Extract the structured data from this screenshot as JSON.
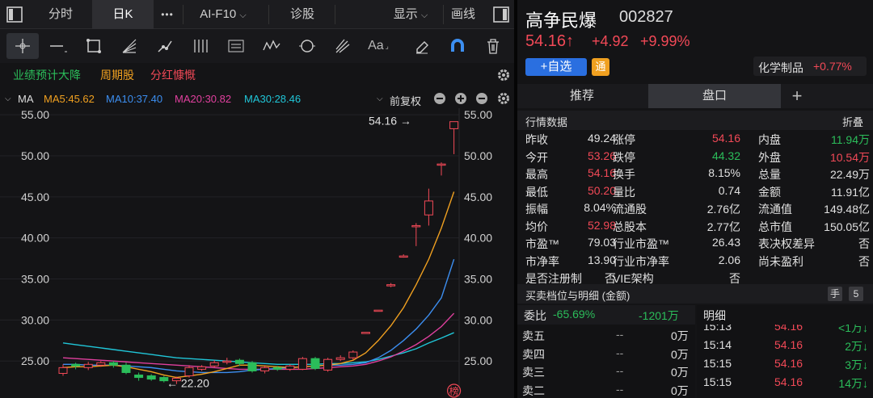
{
  "topbar": {
    "tab_intraday": "分时",
    "tab_daily": "日K",
    "more": "•••",
    "tab_f10": "AI-F10",
    "tab_diagnose": "诊股",
    "display": "显示",
    "draw": "画线"
  },
  "tags": [
    "业绩预计大降",
    "周期股",
    "分红慷慨"
  ],
  "tag_colors": [
    "#2bbd5a",
    "#f0a020",
    "#f24957"
  ],
  "ma": {
    "label": "MA",
    "ma5": "MA5:45.62",
    "ma10": "MA10:37.40",
    "ma20": "MA20:30.82",
    "ma30": "MA30:28.46",
    "adjust": "前复权",
    "colors": {
      "ma5": "#f0a020",
      "ma10": "#3c8ef0",
      "ma20": "#e0409e",
      "ma30": "#20c6d8"
    }
  },
  "stock": {
    "name": "高争民爆",
    "code": "002827",
    "price": "54.16↑",
    "change": "+4.92",
    "pct": "+9.99%",
    "add_watch": "+自选",
    "tong": "通",
    "industry": "化学制品",
    "industry_pct": "+0.77%"
  },
  "right_tabs": {
    "tab1": "推荐",
    "tab2": "盘口",
    "add": "+"
  },
  "quote": {
    "title": "行情数据",
    "collapse": "折叠",
    "rows": [
      [
        [
          "昨收",
          "49.24",
          "white"
        ],
        [
          "涨停",
          "54.16",
          "red"
        ],
        [
          "内盘",
          "11.94万",
          "green"
        ]
      ],
      [
        [
          "今开",
          "53.26",
          "red"
        ],
        [
          "跌停",
          "44.32",
          "green"
        ],
        [
          "外盘",
          "10.54万",
          "red"
        ]
      ],
      [
        [
          "最高",
          "54.16",
          "red"
        ],
        [
          "换手",
          "8.15%",
          "white"
        ],
        [
          "总量",
          "22.49万",
          "white"
        ]
      ],
      [
        [
          "最低",
          "50.20",
          "red"
        ],
        [
          "量比",
          "0.74",
          "white"
        ],
        [
          "金额",
          "11.91亿",
          "white"
        ]
      ],
      [
        [
          "振幅",
          "8.04%",
          "white"
        ],
        [
          "流通股",
          "2.76亿",
          "white"
        ],
        [
          "流通值",
          "149.48亿",
          "white"
        ]
      ],
      [
        [
          "均价",
          "52.98",
          "red"
        ],
        [
          "总股本",
          "2.77亿",
          "white"
        ],
        [
          "总市值",
          "150.05亿",
          "white"
        ]
      ],
      [
        [
          "市盈™",
          "79.03",
          "white"
        ],
        [
          "行业市盈™",
          "26.43",
          "white"
        ],
        [
          "表决权差异",
          "否",
          "white"
        ]
      ],
      [
        [
          "市净率",
          "13.90",
          "white"
        ],
        [
          "行业市净率",
          "2.06",
          "white"
        ],
        [
          "尚未盈利",
          "否",
          "white"
        ]
      ],
      [
        [
          "是否注册制",
          "否",
          "white"
        ],
        [
          "VIE架构",
          "否",
          "white"
        ],
        [
          "",
          "",
          ""
        ]
      ]
    ]
  },
  "orderbook": {
    "title": "买卖档位与明细 (金额)",
    "hand": "手",
    "num": "5",
    "ratio_label": "委比",
    "ratio": "-65.69%",
    "diff": "-1201万",
    "detail_title": "明细",
    "sells": [
      [
        "卖五",
        "--",
        "0万"
      ],
      [
        "卖四",
        "--",
        "0万"
      ],
      [
        "卖三",
        "--",
        "0万"
      ],
      [
        "卖二",
        "--",
        "0万"
      ]
    ],
    "ticks": [
      [
        "15:13",
        "54.16",
        "<1万↓"
      ],
      [
        "15:14",
        "54.16",
        "2万↓"
      ],
      [
        "15:15",
        "54.16",
        "3万↓"
      ],
      [
        "15:15",
        "54.16",
        "14万↓"
      ]
    ]
  },
  "chart_data": {
    "type": "candlestick",
    "y_ticks": [
      "55.00",
      "50.00",
      "45.00",
      "40.00",
      "35.00",
      "30.00",
      "25.00"
    ],
    "ylim": [
      20.5,
      55.8
    ],
    "high_label": "54.16",
    "low_label": "22.20",
    "badge": "榜",
    "candles": [
      {
        "o": 23.5,
        "c": 24.2,
        "h": 24.6,
        "l": 23.2
      },
      {
        "o": 24.6,
        "c": 24.4,
        "h": 24.8,
        "l": 24.0
      },
      {
        "o": 24.2,
        "c": 24.6,
        "h": 24.9,
        "l": 23.9
      },
      {
        "o": 24.5,
        "c": 24.8,
        "h": 25.0,
        "l": 24.3
      },
      {
        "o": 24.8,
        "c": 24.5,
        "h": 25.0,
        "l": 24.2
      },
      {
        "o": 24.5,
        "c": 23.6,
        "h": 24.8,
        "l": 23.4
      },
      {
        "o": 23.3,
        "c": 23.0,
        "h": 23.6,
        "l": 22.6
      },
      {
        "o": 23.2,
        "c": 22.8,
        "h": 23.4,
        "l": 22.6
      },
      {
        "o": 23.0,
        "c": 22.6,
        "h": 23.2,
        "l": 22.4
      },
      {
        "o": 22.6,
        "c": 22.9,
        "h": 23.1,
        "l": 22.2
      },
      {
        "o": 23.2,
        "c": 24.2,
        "h": 24.5,
        "l": 23.0
      },
      {
        "o": 24.0,
        "c": 24.3,
        "h": 24.5,
        "l": 23.8
      },
      {
        "o": 24.4,
        "c": 24.8,
        "h": 25.1,
        "l": 24.2
      },
      {
        "o": 24.9,
        "c": 25.0,
        "h": 25.4,
        "l": 24.6
      },
      {
        "o": 25.1,
        "c": 24.7,
        "h": 25.3,
        "l": 24.4
      },
      {
        "o": 24.8,
        "c": 23.8,
        "h": 25.0,
        "l": 23.6
      },
      {
        "o": 23.8,
        "c": 24.2,
        "h": 24.5,
        "l": 23.5
      },
      {
        "o": 24.2,
        "c": 24.0,
        "h": 24.4,
        "l": 23.8
      },
      {
        "o": 24.0,
        "c": 24.4,
        "h": 24.6,
        "l": 23.8
      },
      {
        "o": 24.0,
        "c": 25.3,
        "h": 25.5,
        "l": 23.9
      },
      {
        "o": 25.3,
        "c": 24.1,
        "h": 25.5,
        "l": 23.9
      },
      {
        "o": 23.9,
        "c": 25.2,
        "h": 25.4,
        "l": 23.7
      },
      {
        "o": 25.2,
        "c": 25.4,
        "h": 25.7,
        "l": 25.0
      },
      {
        "o": 25.4,
        "c": 26.1,
        "h": 26.3,
        "l": 25.2
      },
      {
        "o": 28.5,
        "c": 28.5,
        "h": 28.5,
        "l": 28.5
      },
      {
        "o": 31.2,
        "c": 31.2,
        "h": 31.2,
        "l": 31.2
      },
      {
        "o": 34.3,
        "c": 34.3,
        "h": 34.5,
        "l": 34.0
      },
      {
        "o": 37.8,
        "c": 37.8,
        "h": 38.0,
        "l": 37.6
      },
      {
        "o": 41.5,
        "c": 41.5,
        "h": 41.8,
        "l": 39.0
      },
      {
        "o": 42.8,
        "c": 44.5,
        "h": 46.0,
        "l": 41.5
      },
      {
        "o": 49.0,
        "c": 49.0,
        "h": 49.2,
        "l": 47.6
      },
      {
        "o": 53.3,
        "c": 54.16,
        "h": 54.16,
        "l": 50.2
      }
    ],
    "ma5": [
      24.2,
      24.3,
      24.3,
      24.4,
      24.5,
      24.3,
      24.0,
      23.7,
      23.3,
      23.0,
      23.2,
      23.4,
      23.7,
      24.1,
      24.5,
      24.5,
      24.4,
      24.3,
      24.2,
      24.3,
      24.4,
      24.5,
      24.7,
      25.1,
      26.0,
      27.5,
      29.3,
      31.5,
      34.3,
      37.4,
      41.2,
      45.62
    ],
    "ma10": [
      24.6,
      24.6,
      24.5,
      24.5,
      24.5,
      24.4,
      24.3,
      24.2,
      24.0,
      23.8,
      23.7,
      23.6,
      23.6,
      23.6,
      23.7,
      23.9,
      24.0,
      24.1,
      24.2,
      24.3,
      24.4,
      24.5,
      24.5,
      24.6,
      24.8,
      25.4,
      26.3,
      27.5,
      28.9,
      30.6,
      32.7,
      37.4
    ],
    "ma20": [
      25.4,
      25.3,
      25.2,
      25.1,
      25.0,
      24.9,
      24.8,
      24.7,
      24.6,
      24.5,
      24.4,
      24.3,
      24.2,
      24.1,
      24.0,
      24.0,
      24.0,
      24.0,
      24.0,
      24.0,
      24.1,
      24.2,
      24.3,
      24.4,
      24.6,
      25.0,
      25.5,
      26.2,
      27.0,
      28.0,
      29.2,
      30.82
    ],
    "ma30": [
      27.2,
      27.0,
      26.8,
      26.6,
      26.4,
      26.2,
      26.0,
      25.8,
      25.6,
      25.4,
      25.3,
      25.2,
      25.1,
      25.0,
      24.9,
      24.8,
      24.7,
      24.6,
      24.6,
      24.6,
      24.6,
      24.7,
      24.7,
      24.8,
      24.9,
      25.2,
      25.6,
      26.0,
      26.5,
      27.2,
      27.8,
      28.46
    ]
  }
}
